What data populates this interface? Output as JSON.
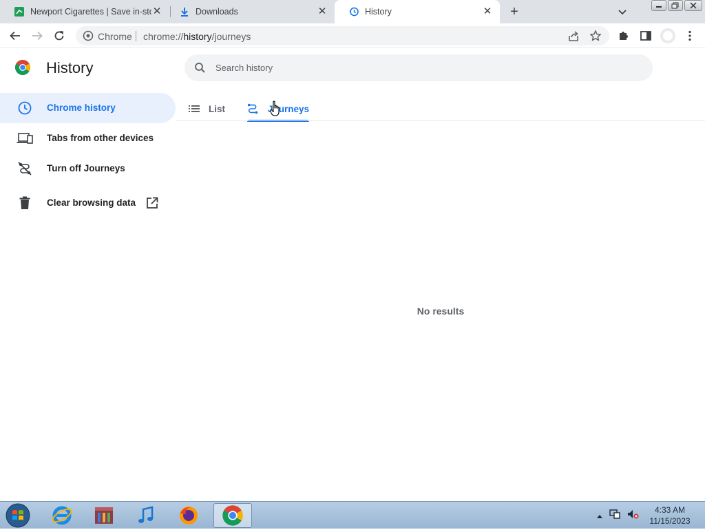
{
  "browser": {
    "tabs": [
      {
        "title": "Newport Cigarettes | Save in-sto",
        "favicon": "newport-favicon",
        "active": false
      },
      {
        "title": "Downloads",
        "favicon": "download-icon",
        "active": false
      },
      {
        "title": "History",
        "favicon": "history-icon",
        "active": true
      }
    ],
    "omnibox": {
      "site_label": "Chrome",
      "url_prefix": "chrome://",
      "url_host": "history",
      "url_path": "/journeys"
    }
  },
  "page": {
    "title": "History",
    "search_placeholder": "Search history",
    "sidebar": [
      {
        "label": "Chrome history",
        "icon": "clock-icon",
        "selected": true
      },
      {
        "label": "Tabs from other devices",
        "icon": "devices-icon",
        "selected": false
      },
      {
        "label": "Turn off Journeys",
        "icon": "journeys-off-icon",
        "selected": false
      },
      {
        "label": "Clear browsing data",
        "icon": "trash-icon",
        "selected": false
      }
    ],
    "view_tabs": [
      {
        "label": "List",
        "active": false
      },
      {
        "label": "Journeys",
        "active": true
      }
    ],
    "empty_message": "No results"
  },
  "taskbar": {
    "apps": [
      "internet-explorer",
      "archive-app",
      "itunes",
      "firefox",
      "chrome"
    ],
    "clock_time": "4:33 AM",
    "clock_date": "11/15/2023"
  },
  "colors": {
    "accent": "#1a73e8",
    "selected_bg": "#e8f0fe",
    "tabstrip": "#dee1e6"
  }
}
